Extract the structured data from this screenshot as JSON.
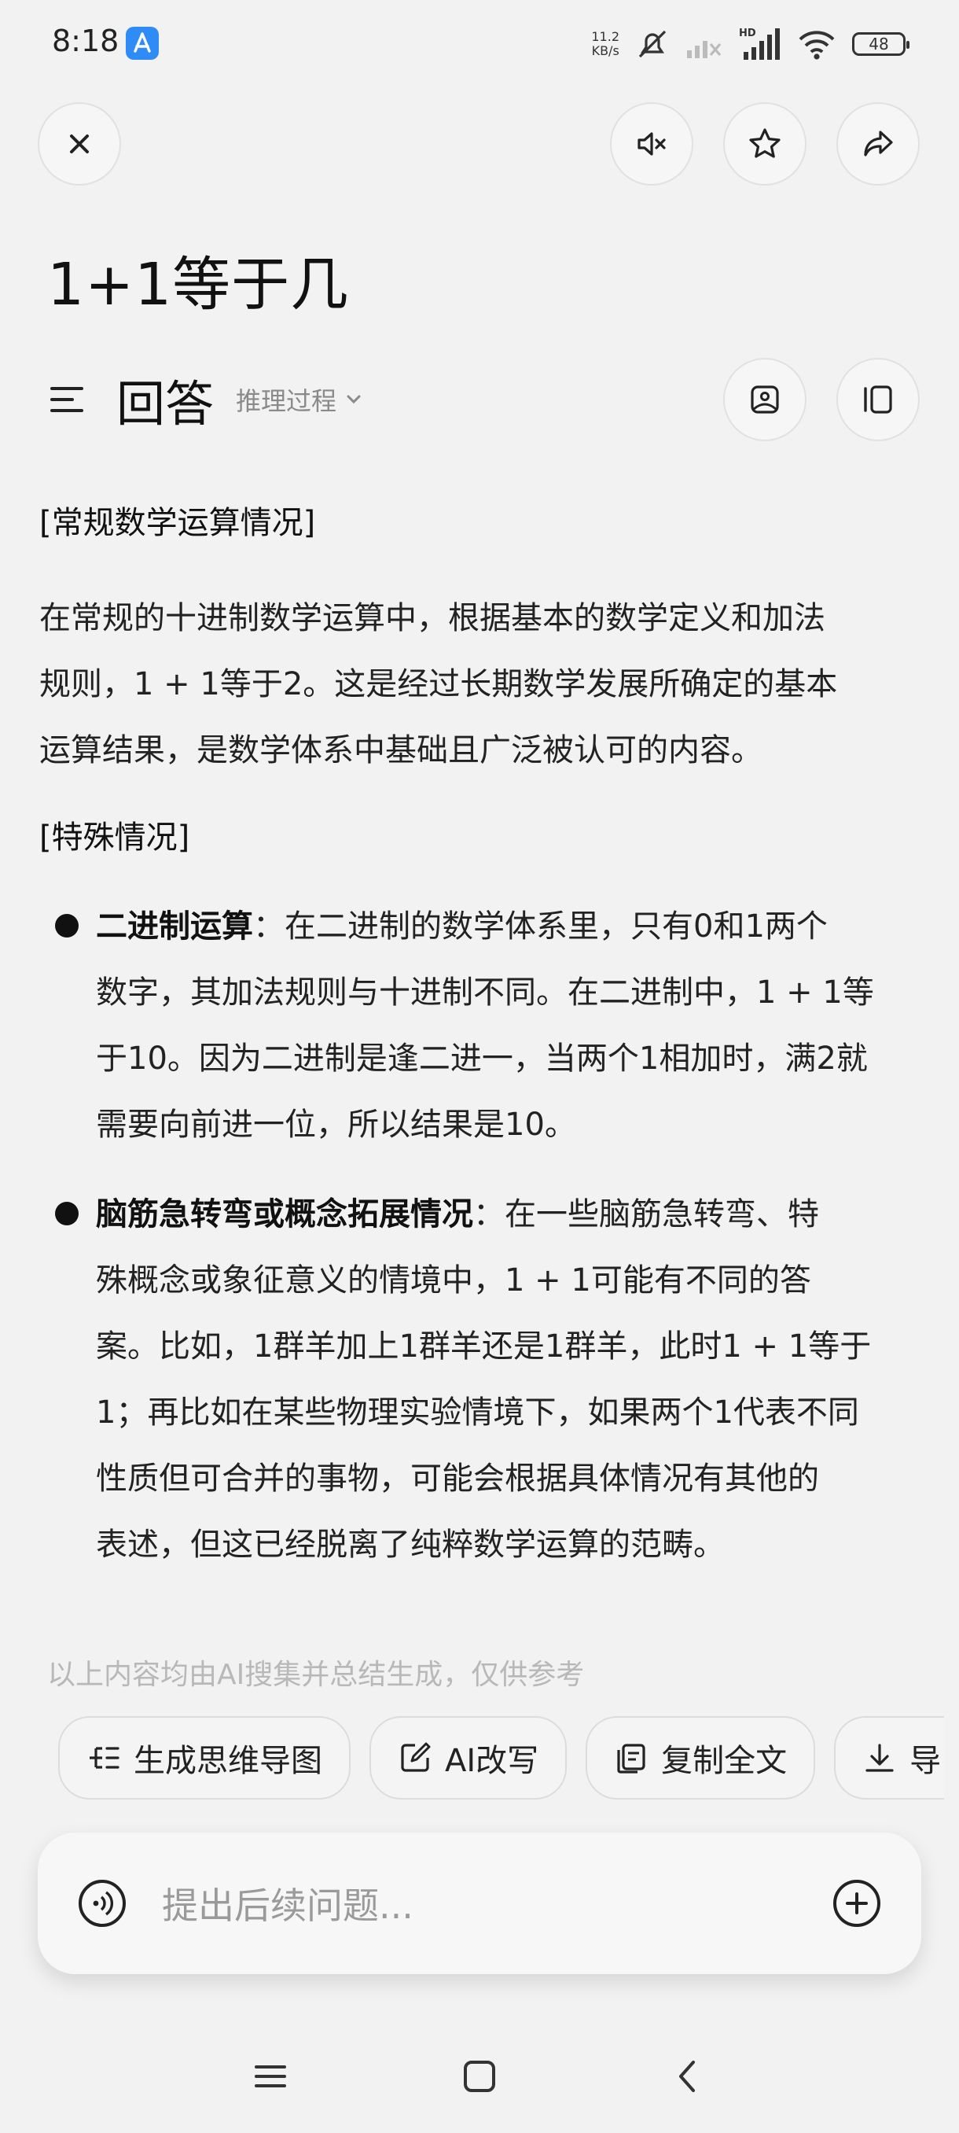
{
  "status_bar": {
    "time": "8:18",
    "net_speed_value": "11.2",
    "net_speed_unit": "KB/s",
    "battery": "48"
  },
  "header": {
    "question": "1+1等于几",
    "answer_label": "回答",
    "reasoning_label": "推理过程"
  },
  "content": {
    "section1_title": "[常规数学运算情况]",
    "section1_lines": [
      "在常规的十进制数学运算中，根据基本的数学定义和加法",
      "规则，1 + 1等于2。这是经过长期数学发展所确定的基本",
      "运算结果，是数学体系中基础且广泛被认可的内容。"
    ],
    "section2_title": "[特殊情况]",
    "bullets": [
      {
        "term": "二进制运算",
        "lines": [
          "：在二进制的数学体系里，只有0和1两个",
          "数字，其加法规则与十进制不同。在二进制中，1 + 1等",
          "于10。因为二进制是逢二进一，当两个1相加时，满2就",
          "需要向前进一位，所以结果是10。"
        ]
      },
      {
        "term": "脑筋急转弯或概念拓展情况",
        "lines": [
          "：在一些脑筋急转弯、特",
          "殊概念或象征意义的情境中，1 + 1可能有不同的答",
          "案。比如，1群羊加上1群羊还是1群羊，此时1 + 1等于",
          "1；再比如在某些物理实验情境下，如果两个1代表不同",
          "性质但可合并的事物，可能会根据具体情况有其他的",
          "表述，但这已经脱离了纯粹数学运算的范畴。"
        ]
      }
    ],
    "disclaimer": "以上内容均由AI搜集并总结生成，仅供参考"
  },
  "actions": {
    "mindmap": "生成思维导图",
    "rewrite": "AI改写",
    "copy": "复制全文",
    "export": "导"
  },
  "input": {
    "placeholder": "提出后续问题..."
  },
  "icons": {
    "close": "close-icon",
    "mute": "mute-icon",
    "star": "star-icon",
    "share": "share-icon",
    "menu": "menu-icon",
    "image": "image-icon",
    "panel": "panel-icon",
    "voice": "voice-icon",
    "plus": "plus-icon"
  }
}
